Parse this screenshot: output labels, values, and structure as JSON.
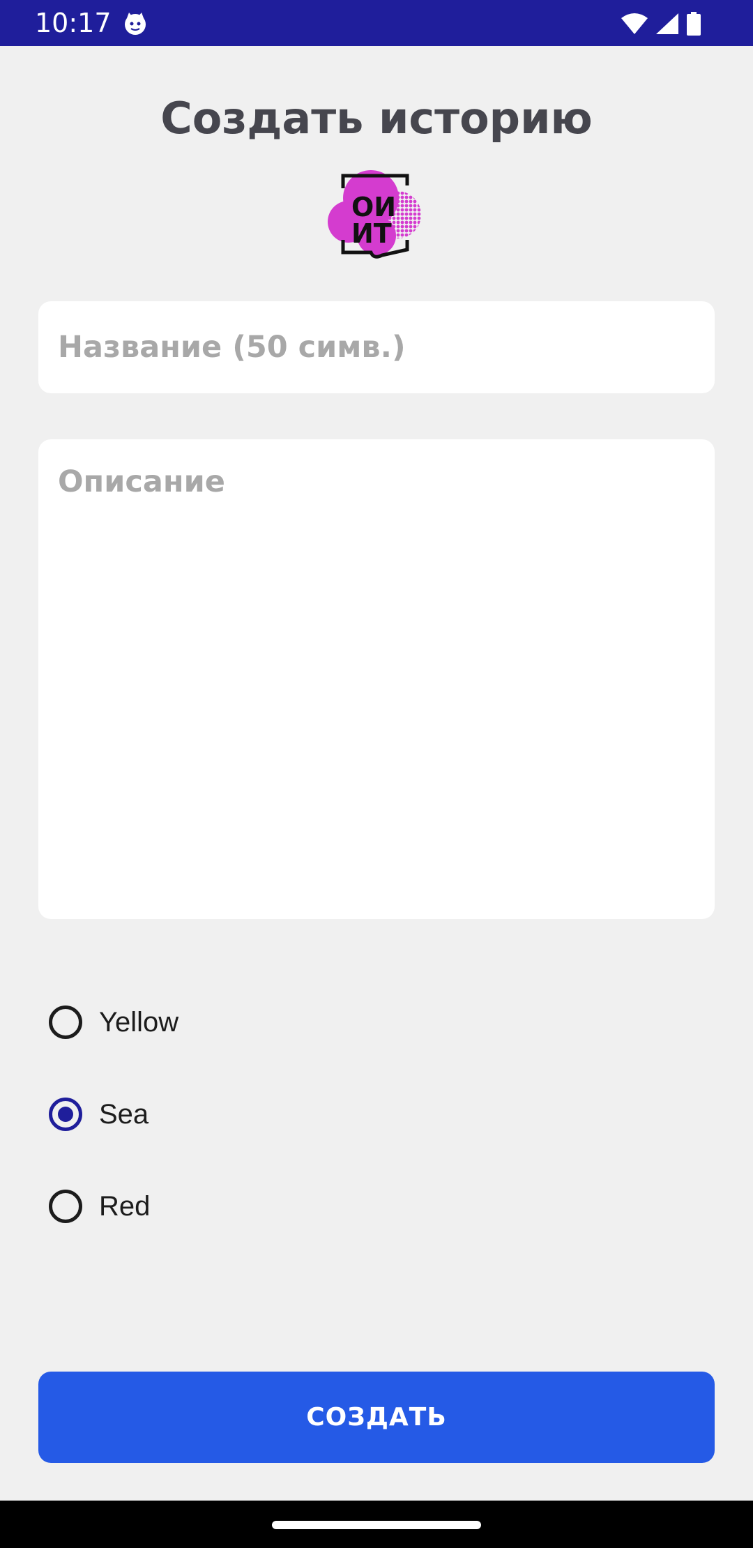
{
  "status_bar": {
    "time": "10:17",
    "icons": [
      "cat-app-icon",
      "wifi-icon",
      "signal-icon",
      "battery-icon"
    ],
    "background": "#1f1e9b"
  },
  "page": {
    "title": "Создать историю",
    "logo": {
      "icon": "oiit-logo",
      "accent": "#d43ccf"
    }
  },
  "form": {
    "title_placeholder": "Название (50 симв.)",
    "description_placeholder": "Описание",
    "color_options": [
      {
        "label": "Yellow",
        "selected": false
      },
      {
        "label": "Sea",
        "selected": true
      },
      {
        "label": "Red",
        "selected": false
      }
    ],
    "radio_accent": "#1f1e9b"
  },
  "actions": {
    "create_label": "СОЗДАТЬ",
    "button_color": "#255ae6"
  }
}
